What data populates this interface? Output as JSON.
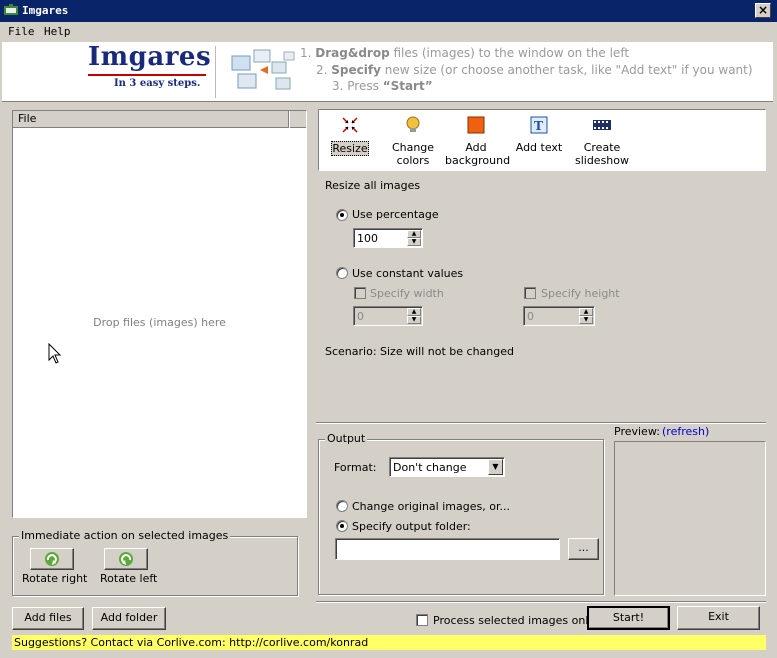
{
  "window": {
    "title": "Imgares",
    "close_icon": "close-icon"
  },
  "menu": {
    "file": "File",
    "help": "Help"
  },
  "banner": {
    "logo": "Imgares",
    "tagline": "In 3 easy steps.",
    "step1_num": "1.",
    "step1_bold": "Drag&drop",
    "step1_rest": " files (images)  to the window on the left",
    "step2_num": "2.",
    "step2_bold": "Specify",
    "step2_rest": " new size (or choose another task, like \"Add text\" if you want)",
    "step3_num": "3.",
    "step3_pre": "Press ",
    "step3_bold": "“Start”"
  },
  "file_list": {
    "column": "File",
    "drop_hint": "Drop files (images) here"
  },
  "immediate": {
    "legend": "Immediate action on selected images",
    "rotate_right": "Rotate right",
    "rotate_left": "Rotate left"
  },
  "buttons": {
    "add_files": "Add files",
    "add_folder": "Add folder",
    "start": "Start!",
    "exit": "Exit",
    "browse": "..."
  },
  "tasks": [
    {
      "label": "Resize",
      "icon": "resize-icon",
      "selected": true
    },
    {
      "label": "Change colors",
      "icon": "lightbulb-icon",
      "selected": false
    },
    {
      "label": "Add background",
      "icon": "background-icon",
      "selected": false
    },
    {
      "label": "Add text",
      "icon": "text-icon",
      "selected": false
    },
    {
      "label": "Create slideshow",
      "icon": "filmstrip-icon",
      "selected": false
    }
  ],
  "resize": {
    "heading": "Resize all images",
    "use_percentage": "Use percentage",
    "percentage_value": "100",
    "use_constant": "Use constant values",
    "specify_width": "Specify width",
    "width_value": "0",
    "specify_height": "Specify height",
    "height_value": "0",
    "scenario": "Scenario: Size will not be changed",
    "selected_mode": "percentage"
  },
  "output": {
    "legend": "Output",
    "format_label": "Format:",
    "format_value": "Don't change",
    "change_original": "Change original images, or...",
    "specify_folder": "Specify output folder:",
    "folder_value": "",
    "selected_mode": "folder"
  },
  "preview": {
    "label": "Preview:",
    "refresh": "(refresh)"
  },
  "process_selected": "Process selected images only",
  "status": "Suggestions? Contact via Corlive.com: http://corlive.com/konrad",
  "colors": {
    "titlebar": "#0a246a",
    "window_bg": "#d4d0c8",
    "status_bg": "#ffff66",
    "logo": "#1a2a7a",
    "link": "#0000cc"
  }
}
